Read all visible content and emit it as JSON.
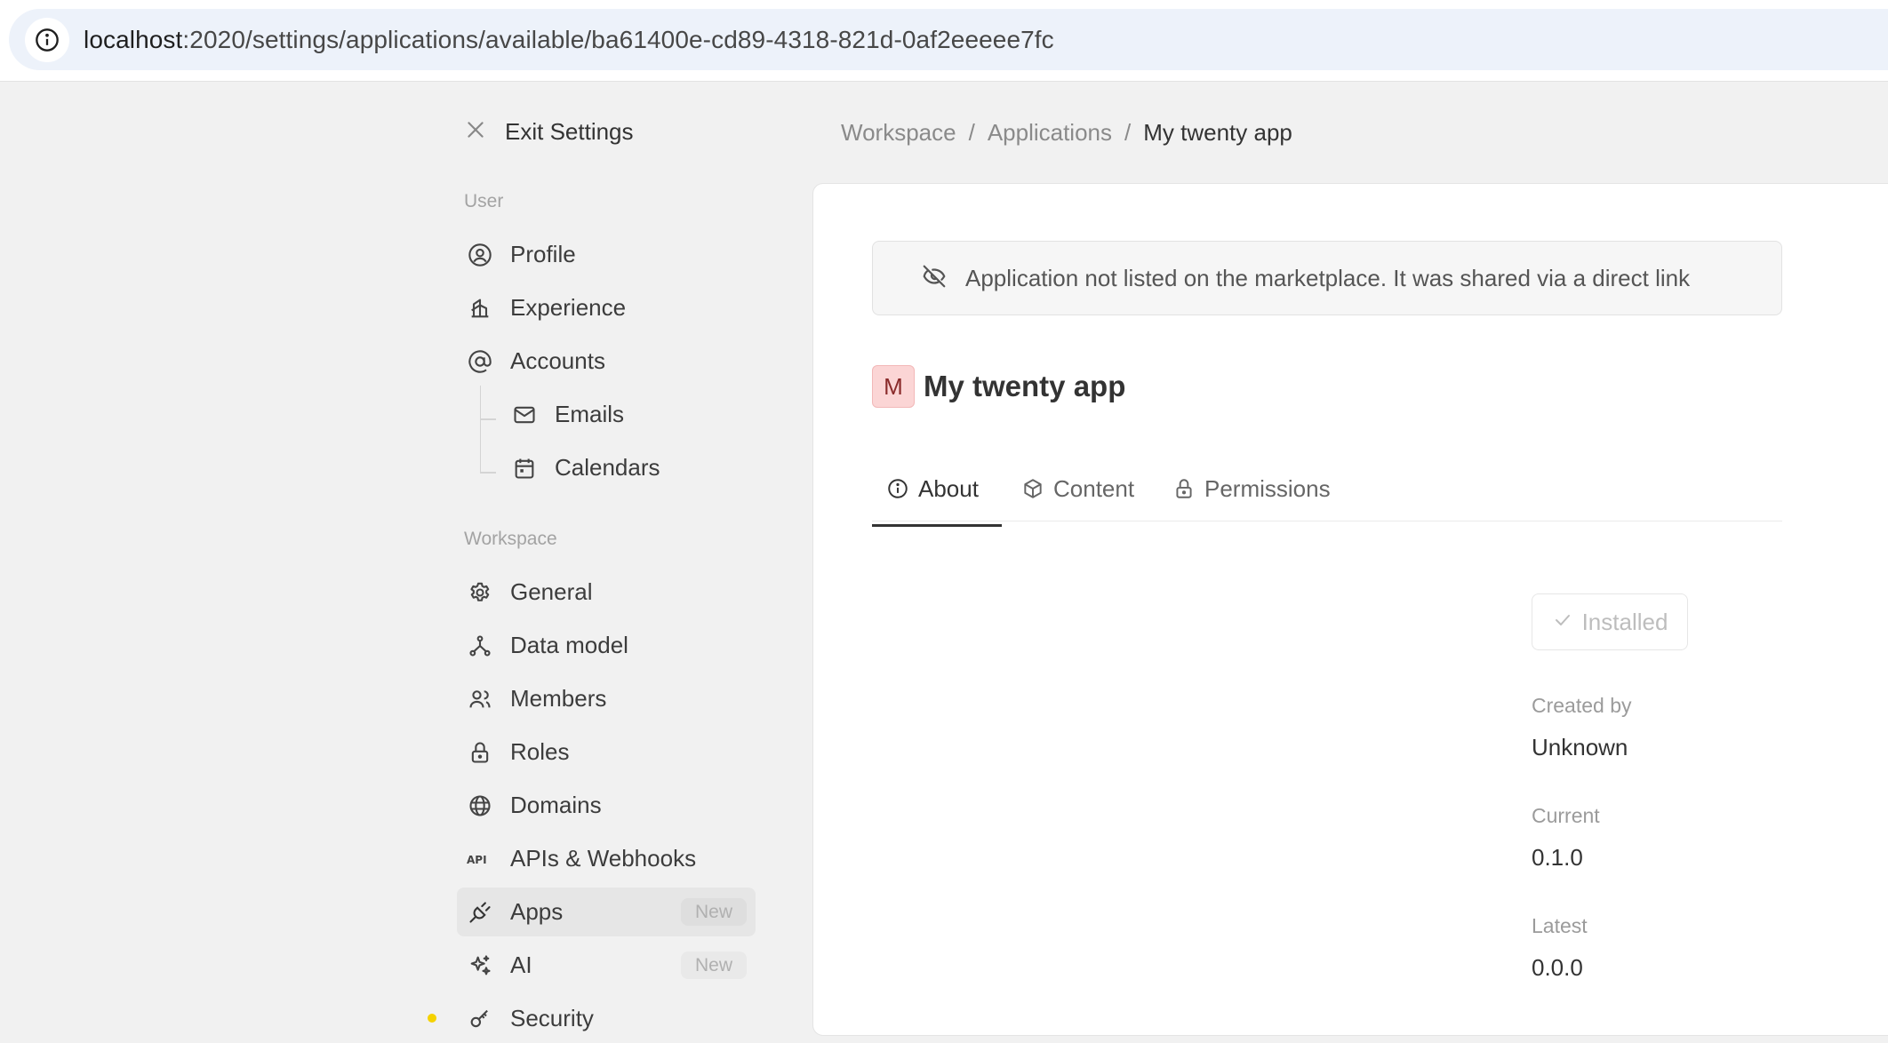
{
  "browser": {
    "url_host": "localhost",
    "url_path": ":2020/settings/applications/available/ba61400e-cd89-4318-821d-0af2eeeee7fc"
  },
  "sidebar": {
    "exit_label": "Exit Settings",
    "user_section": "User",
    "user_items": [
      {
        "label": "Profile",
        "icon": "user-circle-icon"
      },
      {
        "label": "Experience",
        "icon": "experience-icon"
      },
      {
        "label": "Accounts",
        "icon": "at-icon"
      },
      {
        "label": "Emails",
        "icon": "mail-icon"
      },
      {
        "label": "Calendars",
        "icon": "calendar-icon"
      }
    ],
    "workspace_section": "Workspace",
    "workspace_items": [
      {
        "label": "General",
        "icon": "gear-icon"
      },
      {
        "label": "Data model",
        "icon": "hierarchy-icon"
      },
      {
        "label": "Members",
        "icon": "users-icon"
      },
      {
        "label": "Roles",
        "icon": "lock-icon"
      },
      {
        "label": "Domains",
        "icon": "globe-icon"
      },
      {
        "label": "APIs & Webhooks",
        "icon": "api-icon"
      },
      {
        "label": "Apps",
        "icon": "plug-icon",
        "badge": "New",
        "active": true
      },
      {
        "label": "AI",
        "icon": "sparkles-icon",
        "badge": "New"
      },
      {
        "label": "Security",
        "icon": "key-icon"
      }
    ]
  },
  "breadcrumb": {
    "items": [
      "Workspace",
      "Applications"
    ],
    "separator": "/",
    "current": "My twenty app"
  },
  "main": {
    "notice": "Application not listed on the marketplace. It was shared via a direct link",
    "app_avatar": "M",
    "app_name": "My twenty app",
    "tabs": [
      {
        "label": "About",
        "icon": "info-icon",
        "active": true
      },
      {
        "label": "Content",
        "icon": "box-icon"
      },
      {
        "label": "Permissions",
        "icon": "lock-icon"
      }
    ],
    "install_button": "Installed",
    "meta": [
      {
        "label": "Created by",
        "value": "Unknown"
      },
      {
        "label": "Current",
        "value": "0.1.0"
      },
      {
        "label": "Latest",
        "value": "0.0.0"
      }
    ]
  },
  "colors": {
    "accent_avatar_bg": "#fbd5d5",
    "active_nav_bg": "#e6e6e6",
    "address_bar_bg": "#edf2fa"
  }
}
